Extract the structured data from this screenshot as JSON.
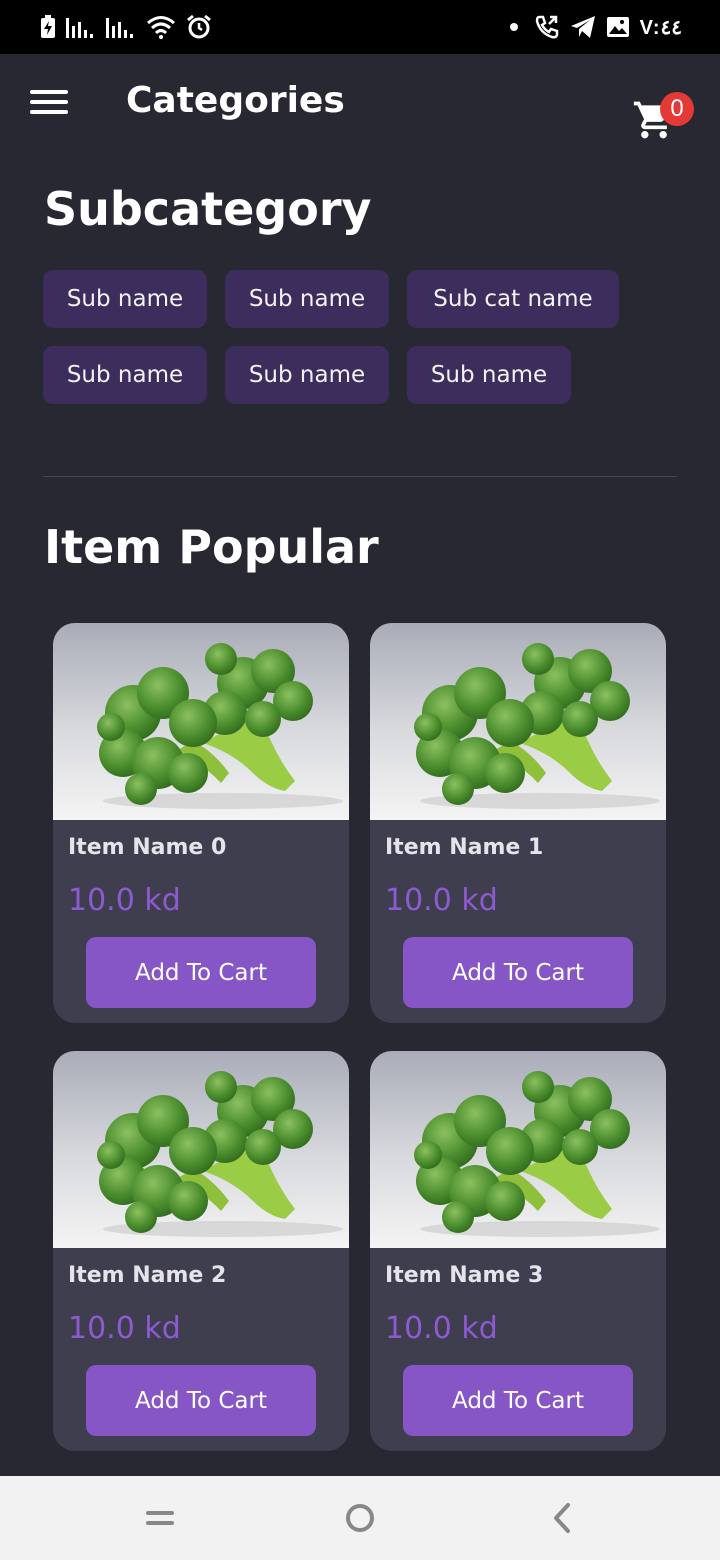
{
  "status_bar": {
    "time": "V:٤٤",
    "left_icons": [
      "battery-saver-icon",
      "signal-icon",
      "signal-icon",
      "wifi-icon",
      "alarm-icon"
    ],
    "right_icons": [
      "dot-icon",
      "call-icon",
      "telegram-icon",
      "image-icon"
    ]
  },
  "app_bar": {
    "title": "Categories",
    "cart_count": "0"
  },
  "subcategory": {
    "title": "Subcategory",
    "chips": [
      "Sub name",
      "Sub name",
      "Sub cat name",
      "Sub name",
      "Sub name",
      "Sub name"
    ]
  },
  "popular": {
    "title": "Item Popular",
    "items": [
      {
        "name": "Item Name 0",
        "price": "10.0 kd",
        "button": "Add To Cart"
      },
      {
        "name": "Item Name 1",
        "price": "10.0 kd",
        "button": "Add To Cart"
      },
      {
        "name": "Item Name 2",
        "price": "10.0 kd",
        "button": "Add To Cart"
      },
      {
        "name": "Item Name 3",
        "price": "10.0 kd",
        "button": "Add To Cart"
      }
    ]
  },
  "colors": {
    "background": "#282833",
    "chip": "#3d2d5c",
    "card": "#3f3e4e",
    "accent": "#8756c6",
    "price": "#8e5ad1",
    "badge": "#e53935"
  },
  "nav_bar": {
    "icons": [
      "recent-apps-icon",
      "home-icon",
      "back-icon"
    ]
  }
}
